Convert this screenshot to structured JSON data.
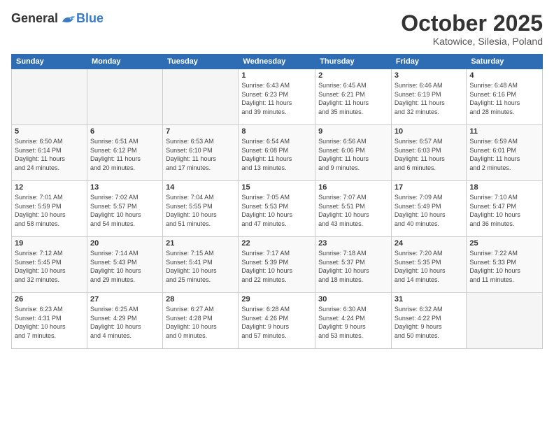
{
  "header": {
    "logo_general": "General",
    "logo_blue": "Blue",
    "month_title": "October 2025",
    "location": "Katowice, Silesia, Poland"
  },
  "weekdays": [
    "Sunday",
    "Monday",
    "Tuesday",
    "Wednesday",
    "Thursday",
    "Friday",
    "Saturday"
  ],
  "weeks": [
    [
      {
        "day": "",
        "info": ""
      },
      {
        "day": "",
        "info": ""
      },
      {
        "day": "",
        "info": ""
      },
      {
        "day": "1",
        "info": "Sunrise: 6:43 AM\nSunset: 6:23 PM\nDaylight: 11 hours\nand 39 minutes."
      },
      {
        "day": "2",
        "info": "Sunrise: 6:45 AM\nSunset: 6:21 PM\nDaylight: 11 hours\nand 35 minutes."
      },
      {
        "day": "3",
        "info": "Sunrise: 6:46 AM\nSunset: 6:19 PM\nDaylight: 11 hours\nand 32 minutes."
      },
      {
        "day": "4",
        "info": "Sunrise: 6:48 AM\nSunset: 6:16 PM\nDaylight: 11 hours\nand 28 minutes."
      }
    ],
    [
      {
        "day": "5",
        "info": "Sunrise: 6:50 AM\nSunset: 6:14 PM\nDaylight: 11 hours\nand 24 minutes."
      },
      {
        "day": "6",
        "info": "Sunrise: 6:51 AM\nSunset: 6:12 PM\nDaylight: 11 hours\nand 20 minutes."
      },
      {
        "day": "7",
        "info": "Sunrise: 6:53 AM\nSunset: 6:10 PM\nDaylight: 11 hours\nand 17 minutes."
      },
      {
        "day": "8",
        "info": "Sunrise: 6:54 AM\nSunset: 6:08 PM\nDaylight: 11 hours\nand 13 minutes."
      },
      {
        "day": "9",
        "info": "Sunrise: 6:56 AM\nSunset: 6:06 PM\nDaylight: 11 hours\nand 9 minutes."
      },
      {
        "day": "10",
        "info": "Sunrise: 6:57 AM\nSunset: 6:03 PM\nDaylight: 11 hours\nand 6 minutes."
      },
      {
        "day": "11",
        "info": "Sunrise: 6:59 AM\nSunset: 6:01 PM\nDaylight: 11 hours\nand 2 minutes."
      }
    ],
    [
      {
        "day": "12",
        "info": "Sunrise: 7:01 AM\nSunset: 5:59 PM\nDaylight: 10 hours\nand 58 minutes."
      },
      {
        "day": "13",
        "info": "Sunrise: 7:02 AM\nSunset: 5:57 PM\nDaylight: 10 hours\nand 54 minutes."
      },
      {
        "day": "14",
        "info": "Sunrise: 7:04 AM\nSunset: 5:55 PM\nDaylight: 10 hours\nand 51 minutes."
      },
      {
        "day": "15",
        "info": "Sunrise: 7:05 AM\nSunset: 5:53 PM\nDaylight: 10 hours\nand 47 minutes."
      },
      {
        "day": "16",
        "info": "Sunrise: 7:07 AM\nSunset: 5:51 PM\nDaylight: 10 hours\nand 43 minutes."
      },
      {
        "day": "17",
        "info": "Sunrise: 7:09 AM\nSunset: 5:49 PM\nDaylight: 10 hours\nand 40 minutes."
      },
      {
        "day": "18",
        "info": "Sunrise: 7:10 AM\nSunset: 5:47 PM\nDaylight: 10 hours\nand 36 minutes."
      }
    ],
    [
      {
        "day": "19",
        "info": "Sunrise: 7:12 AM\nSunset: 5:45 PM\nDaylight: 10 hours\nand 32 minutes."
      },
      {
        "day": "20",
        "info": "Sunrise: 7:14 AM\nSunset: 5:43 PM\nDaylight: 10 hours\nand 29 minutes."
      },
      {
        "day": "21",
        "info": "Sunrise: 7:15 AM\nSunset: 5:41 PM\nDaylight: 10 hours\nand 25 minutes."
      },
      {
        "day": "22",
        "info": "Sunrise: 7:17 AM\nSunset: 5:39 PM\nDaylight: 10 hours\nand 22 minutes."
      },
      {
        "day": "23",
        "info": "Sunrise: 7:18 AM\nSunset: 5:37 PM\nDaylight: 10 hours\nand 18 minutes."
      },
      {
        "day": "24",
        "info": "Sunrise: 7:20 AM\nSunset: 5:35 PM\nDaylight: 10 hours\nand 14 minutes."
      },
      {
        "day": "25",
        "info": "Sunrise: 7:22 AM\nSunset: 5:33 PM\nDaylight: 10 hours\nand 11 minutes."
      }
    ],
    [
      {
        "day": "26",
        "info": "Sunrise: 6:23 AM\nSunset: 4:31 PM\nDaylight: 10 hours\nand 7 minutes."
      },
      {
        "day": "27",
        "info": "Sunrise: 6:25 AM\nSunset: 4:29 PM\nDaylight: 10 hours\nand 4 minutes."
      },
      {
        "day": "28",
        "info": "Sunrise: 6:27 AM\nSunset: 4:28 PM\nDaylight: 10 hours\nand 0 minutes."
      },
      {
        "day": "29",
        "info": "Sunrise: 6:28 AM\nSunset: 4:26 PM\nDaylight: 9 hours\nand 57 minutes."
      },
      {
        "day": "30",
        "info": "Sunrise: 6:30 AM\nSunset: 4:24 PM\nDaylight: 9 hours\nand 53 minutes."
      },
      {
        "day": "31",
        "info": "Sunrise: 6:32 AM\nSunset: 4:22 PM\nDaylight: 9 hours\nand 50 minutes."
      },
      {
        "day": "",
        "info": ""
      }
    ]
  ]
}
